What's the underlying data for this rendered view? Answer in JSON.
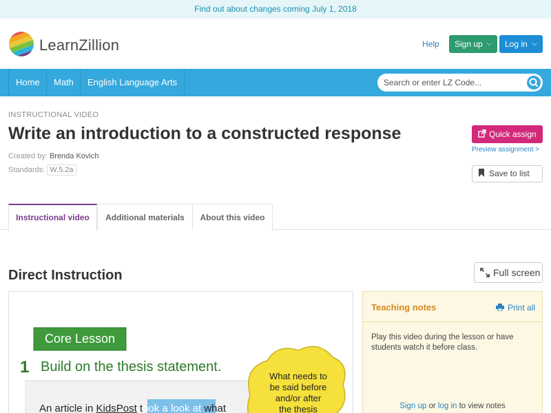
{
  "announcement": "Find out about changes coming July 1, 2018",
  "brand": {
    "name": "LearnZillion"
  },
  "header": {
    "help": "Help",
    "signup": "Sign up",
    "login": "Log in"
  },
  "nav": {
    "items": [
      {
        "label": "Home"
      },
      {
        "label": "Math"
      },
      {
        "label": "English Language Arts"
      }
    ],
    "search_placeholder": "Search or enter LZ Code..."
  },
  "lesson": {
    "eyebrow": "INSTRUCTIONAL VIDEO",
    "title": "Write an introduction to a constructed response",
    "created_by_label": "Created by:",
    "created_by": "Brenda Kovich",
    "standards_label": "Standards:",
    "standard": "W.5.2a"
  },
  "actions": {
    "quick_assign": "Quick assign",
    "preview": "Preview assignment >",
    "save_to_list": "Save to list"
  },
  "tabs": [
    {
      "label": "Instructional video",
      "active": true
    },
    {
      "label": "Additional materials",
      "active": false
    },
    {
      "label": "About this video",
      "active": false
    }
  ],
  "section": {
    "title": "Direct Instruction",
    "fullscreen": "Full screen"
  },
  "video": {
    "badge": "Core Lesson",
    "step_number": "1",
    "step_text": "Build on the thesis statement.",
    "article_text_a": "An article in",
    "article_text_b": "KidsPost",
    "article_text_c": "t",
    "article_text_highlight": "ook a look at",
    "article_text_d": "what",
    "bubble_lines": [
      "What needs to",
      "be said before",
      "and/or after",
      "the thesis"
    ]
  },
  "notes": {
    "title": "Teaching notes",
    "print_all": "Print all",
    "body": "Play this video during the lesson or have students watch it before class.",
    "foot_signup": "Sign up",
    "foot_or": "or",
    "foot_login": "log in",
    "foot_rest": "to view notes"
  },
  "colors": {
    "accent_blue": "#35a8dd",
    "signup_green": "#2e9a6f",
    "login_blue": "#1d8ed4",
    "quick_assign_pink": "#d3297a",
    "tab_active_purple": "#7b3a8c",
    "notes_orange": "#d48a1d"
  }
}
